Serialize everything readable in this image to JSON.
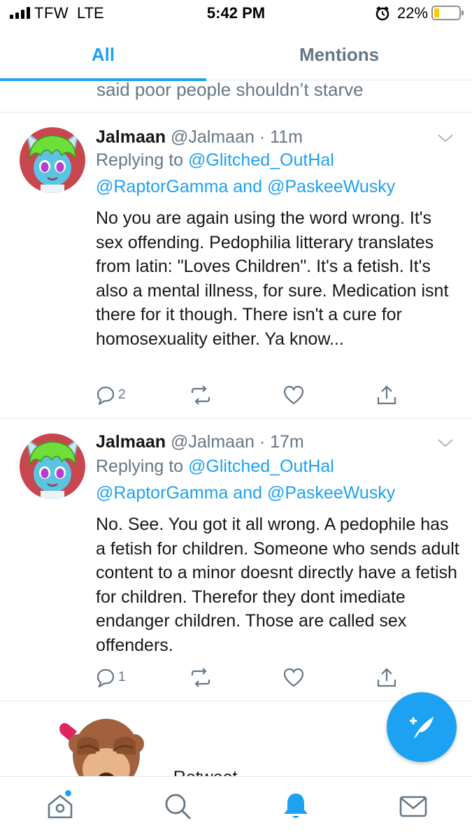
{
  "status_bar": {
    "carrier": "TFW",
    "network": "LTE",
    "time": "5:42 PM",
    "battery_percent": "22%",
    "battery_level": 0.22,
    "battery_color": "#ffcc00"
  },
  "tabs": [
    {
      "label": "All",
      "active": true
    },
    {
      "label": "Mentions",
      "active": false
    }
  ],
  "previous_tweet_tail": "said poor people shouldn’t starve",
  "tweets": [
    {
      "display_name": "Jalmaan",
      "handle": "@Jalmaan",
      "time": "· 11m",
      "replying_to_label": "Replying to",
      "mention_1": "@Glitched_OutHal",
      "mention_2": "@RaptorGamma",
      "and_label": "and",
      "mention_3": "@PaskeeWusky",
      "text": "No you are again using the word wrong. It's sex offending. Pedophilia litterary translates from latin: \"Loves Children\". It's a fetish. It's also a mental illness, for sure. Medication isnt there for it though. There isn't a cure for homosexuality either. Ya know...",
      "reply_count": "2"
    },
    {
      "display_name": "Jalmaan",
      "handle": "@Jalmaan",
      "time": "· 17m",
      "replying_to_label": "Replying to",
      "mention_1": "@Glitched_OutHal",
      "mention_2": "@RaptorGamma",
      "and_label": "and",
      "mention_3": "@PaskeeWusky",
      "text": "No. See. You got it all wrong. A pedophile has a fetish for children. Someone who sends adult content to a minor doesnt directly have a fetish for children. Therefor they dont imediate endanger children. Those are called sex offenders.",
      "reply_count": "1"
    }
  ],
  "partial_text_behind_emoji": "... Retweet",
  "icons": {
    "tab_bar": [
      "home-icon",
      "search-icon",
      "notifications-bell-icon",
      "messages-envelope-icon"
    ],
    "fab": "compose-tweet-icon",
    "overlay": "see-no-evil-monkey-emoji"
  },
  "colors": {
    "accent": "#1da1f2",
    "text": "#14171a",
    "secondary": "#657786"
  }
}
